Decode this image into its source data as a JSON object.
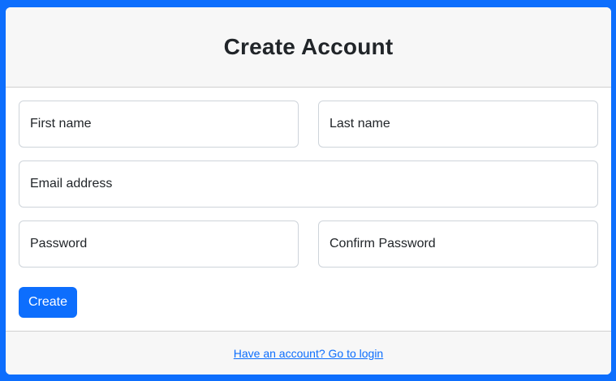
{
  "header": {
    "title": "Create Account"
  },
  "form": {
    "first_name_placeholder": "First name",
    "last_name_placeholder": "Last name",
    "email_placeholder": "Email address",
    "password_placeholder": "Password",
    "confirm_password_placeholder": "Confirm Password",
    "submit_label": "Create"
  },
  "footer": {
    "login_link": "Have an account? Go to login"
  },
  "colors": {
    "accent": "#0d6efd",
    "header_bg": "#f7f7f7",
    "border": "#ced4da"
  }
}
